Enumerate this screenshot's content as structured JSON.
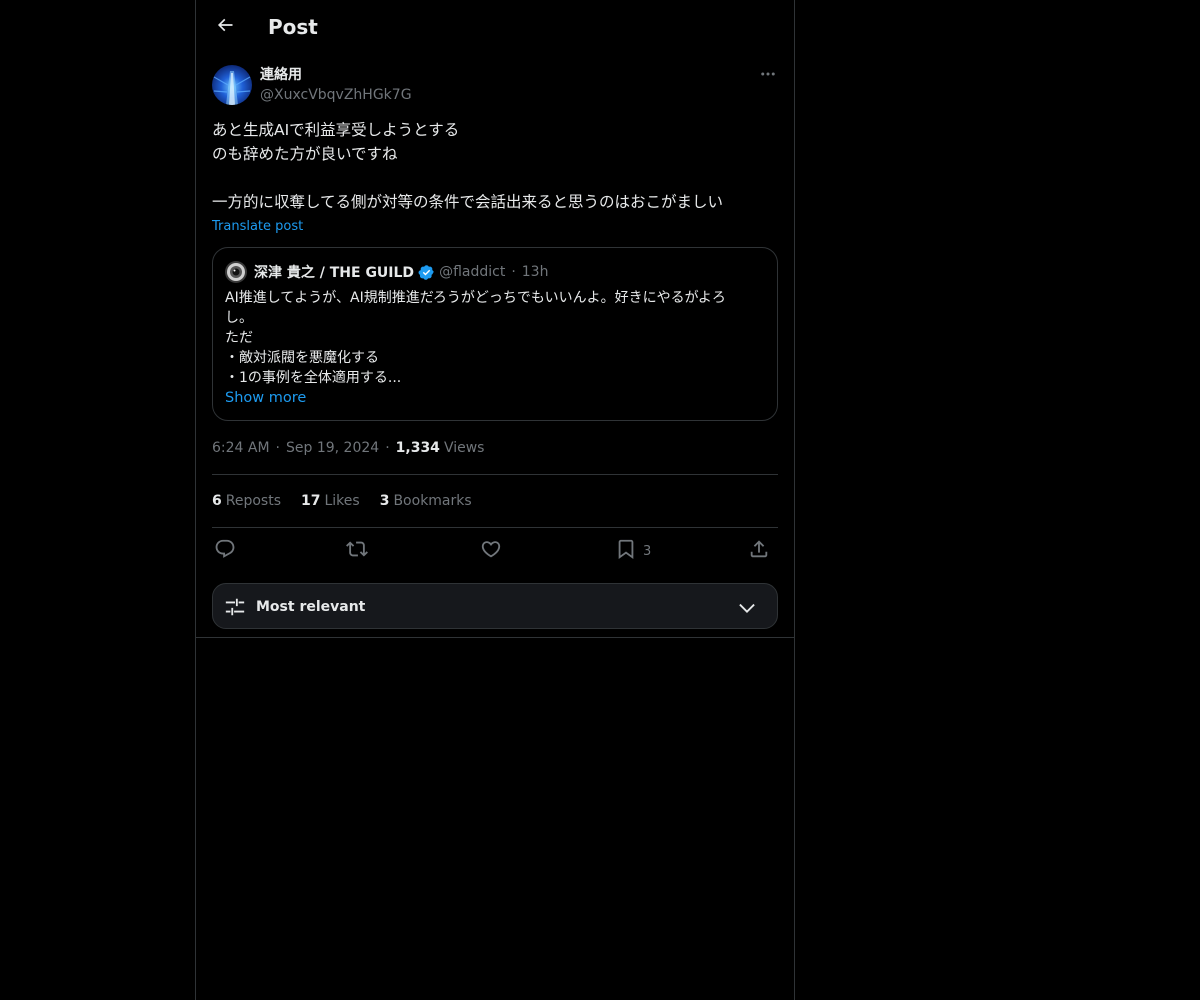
{
  "header": {
    "title": "Post",
    "back_icon": "arrow-left-icon"
  },
  "author": {
    "name": "連絡用",
    "handle": "@XuxcVbqvZhHGk7G"
  },
  "post": {
    "lines": [
      "あと生成AIで利益享受しようとする",
      "のも辞めた方が良いですね",
      "",
      "一方的に収奪してる側が対等の条件で会話出来ると思うのはおこがましい"
    ],
    "translate_label": "Translate post"
  },
  "quote": {
    "name": "深津 貴之 / THE GUILD",
    "handle": "@fladdict",
    "separator": "·",
    "time": "13h",
    "lines": [
      "AI推進してようが、AI規制推進だろうがどっちでもいいんよ。好きにやるがよろ",
      "し。",
      "ただ",
      "・敵対派閥を悪魔化する",
      "・1の事例を全体適用する..."
    ],
    "show_more_label": "Show more"
  },
  "meta": {
    "time": "6:24 AM",
    "date": "Sep 19, 2024",
    "separator": "·",
    "views_count": "1,334",
    "views_label": "Views"
  },
  "stats": {
    "reposts_count": "6",
    "reposts_label": "Reposts",
    "likes_count": "17",
    "likes_label": "Likes",
    "bookmarks_count": "3",
    "bookmarks_label": "Bookmarks"
  },
  "actions": {
    "reply_icon": "reply-icon",
    "repost_icon": "repost-icon",
    "like_icon": "heart-icon",
    "bookmark_icon": "bookmark-icon",
    "bookmark_count": "3",
    "share_icon": "share-icon"
  },
  "sort": {
    "label": "Most relevant",
    "icon": "sliders-icon",
    "chevron": "chevron-down-icon"
  },
  "colors": {
    "background": "#000000",
    "text": "#e7e9ea",
    "muted": "#71767b",
    "accent": "#1d9bf0",
    "border": "#2f3336"
  }
}
